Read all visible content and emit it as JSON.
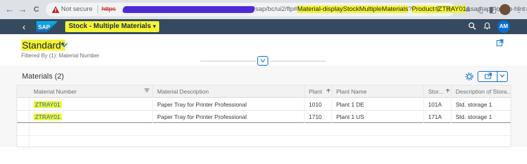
{
  "browser": {
    "back_icon": "←",
    "forward_icon": "→",
    "reload_icon": "C",
    "security_label": "Not secure",
    "url_scheme": "https",
    "url_path_prefix": "sap/bc/ui2/flp#",
    "url_semantic_object": "Material-displayStockMultipleMaterials",
    "url_qmark": "?",
    "url_param": "Product=ZTRAY01",
    "url_tail": "&sap-app-origin-hint=...",
    "icons": [
      "share-icon",
      "star-icon",
      "queue-icon",
      "split-icon",
      "profile-avatar",
      "menu-icon"
    ]
  },
  "shell": {
    "back_icon": "‹",
    "logo_text": "SAP",
    "app_title": "Stock - Multiple Materials",
    "app_title_caret": "▾",
    "search_icon": "⚲",
    "notification_icon": "🔔",
    "user_initials": "AM",
    "accent_color": "#354a5f"
  },
  "filter_header": {
    "variant_name": "Standard*",
    "variant_chevron": "⌄",
    "filtered_by": "Filtered By (1): Material Number",
    "collapse_icon": "⌄",
    "share_icon": "↗"
  },
  "table": {
    "title": "Materials (2)",
    "settings_icon": "⚙",
    "export_icon": "⇪",
    "export_dropdown_icon": "⌄",
    "columns": [
      {
        "label": "Material Number",
        "sort_icon": "⩦"
      },
      {
        "label": "Material Description",
        "sort_icon": ""
      },
      {
        "label": "Plant",
        "sort_icon": "⇧"
      },
      {
        "label": "Plant Name",
        "sort_icon": ""
      },
      {
        "label": "Stor...",
        "sort_icon": "⇧"
      },
      {
        "label": "Description of Stora...",
        "sort_icon": ""
      }
    ],
    "rows": [
      {
        "material": "ZTRAY01",
        "description": "Paper Tray for Printer Professional",
        "plant": "1010",
        "plant_name": "Plant 1 DE",
        "storage": "101A",
        "storage_desc": "Std. storage 1"
      },
      {
        "material": "ZTRAY01",
        "description": "Paper Tray for Printer Professional",
        "plant": "1710",
        "plant_name": "Plant 1 US",
        "storage": "171A",
        "storage_desc": "Std. storage 1"
      }
    ]
  },
  "colors": {
    "highlight": "#f4f435",
    "sap_blue": "#0a6ed1",
    "redaction": "#4b2bd6"
  }
}
